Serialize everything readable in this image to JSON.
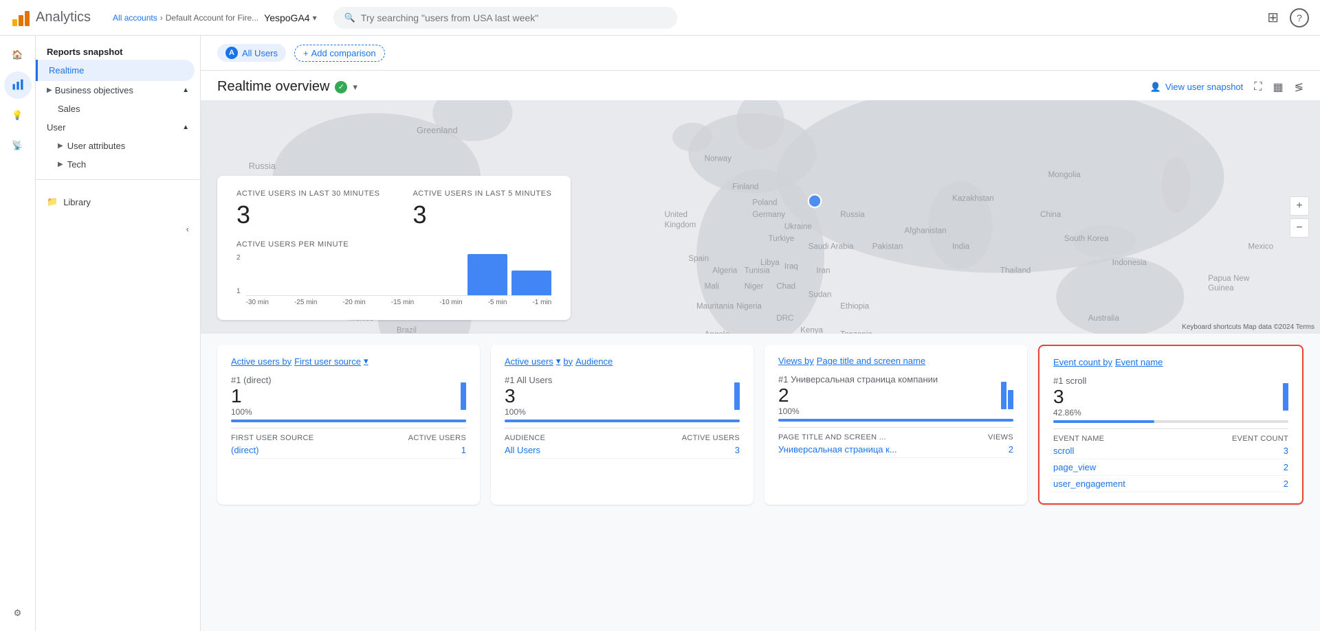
{
  "app": {
    "title": "Analytics",
    "breadcrumb_all": "All accounts",
    "breadcrumb_sep": "›",
    "breadcrumb_account": "Default Account for Fire...",
    "account_name": "YespoGA4",
    "search_placeholder": "Try searching \"users from USA last week\""
  },
  "nav_icons": [
    "home",
    "bar-chart",
    "lightbulb",
    "target"
  ],
  "sidebar": {
    "reports_snapshot": "Reports snapshot",
    "realtime": "Realtime",
    "business_objectives": "Business objectives",
    "sales": "Sales",
    "user_section": "User",
    "user_attributes": "User attributes",
    "tech": "Tech",
    "library": "Library"
  },
  "filter": {
    "all_users_label": "All Users",
    "chip_letter": "A",
    "add_comparison": "Add comparison"
  },
  "overview": {
    "title": "Realtime overview",
    "view_snapshot": "View user snapshot",
    "fullscreen": "⛶",
    "chart_icon": "▦",
    "share": "⊲"
  },
  "stats": {
    "active_30_label": "Active users in last 30 minutes",
    "active_30_value": "3",
    "active_5_label": "Active users in last 5 minutes",
    "active_5_value": "3",
    "per_minute_label": "Active users per minute",
    "time_labels": [
      "-30 min",
      "-25 min",
      "-20 min",
      "-15 min",
      "-10 min",
      "-5 min",
      "-1 min"
    ],
    "y_labels": [
      "2",
      "1"
    ],
    "bars": [
      0,
      0,
      0,
      0,
      0,
      2,
      1.2
    ]
  },
  "cards": [
    {
      "id": "first-user-source",
      "title": "Active users by First user source",
      "title_arrow": "▾",
      "rank": "#1 (direct)",
      "main_value": "1",
      "percent": "100%",
      "bar_fill_pct": 100,
      "col1_header": "FIRST USER SOURCE",
      "col2_header": "ACTIVE USERS",
      "rows": [
        {
          "name": "(direct)",
          "value": "1"
        }
      ],
      "mini_bars": [
        40
      ],
      "highlighted": false
    },
    {
      "id": "audience",
      "title": "Active users",
      "title_by": "by Audience",
      "title_arrow": "▾",
      "rank": "#1 All Users",
      "main_value": "3",
      "percent": "100%",
      "bar_fill_pct": 100,
      "col1_header": "AUDIENCE",
      "col2_header": "ACTIVE USERS",
      "rows": [
        {
          "name": "All Users",
          "value": "3"
        }
      ],
      "mini_bars": [
        40
      ],
      "highlighted": false
    },
    {
      "id": "page-title",
      "title": "Views by Page title and screen name",
      "rank": "#1 Универсальная страница компании",
      "main_value": "2",
      "percent": "100%",
      "bar_fill_pct": 100,
      "col1_header": "PAGE TITLE AND SCREEN ...",
      "col2_header": "VIEWS",
      "rows": [
        {
          "name": "Универсальная страница к...",
          "value": "2"
        }
      ],
      "mini_bars": [
        40
      ],
      "highlighted": false
    },
    {
      "id": "event-count",
      "title": "Event count by Event name",
      "rank": "#1 scroll",
      "main_value": "3",
      "percent": "42.86%",
      "bar_fill_pct": 43,
      "col1_header": "EVENT NAME",
      "col2_header": "EVENT COUNT",
      "rows": [
        {
          "name": "scroll",
          "value": "3"
        },
        {
          "name": "page_view",
          "value": "2"
        },
        {
          "name": "user_engagement",
          "value": "2"
        }
      ],
      "mini_bars": [
        40
      ],
      "highlighted": true
    }
  ],
  "map": {
    "dot_top": "43%",
    "dot_left": "55%",
    "credits": "Keyboard shortcuts  Map data ©2024  Terms"
  }
}
